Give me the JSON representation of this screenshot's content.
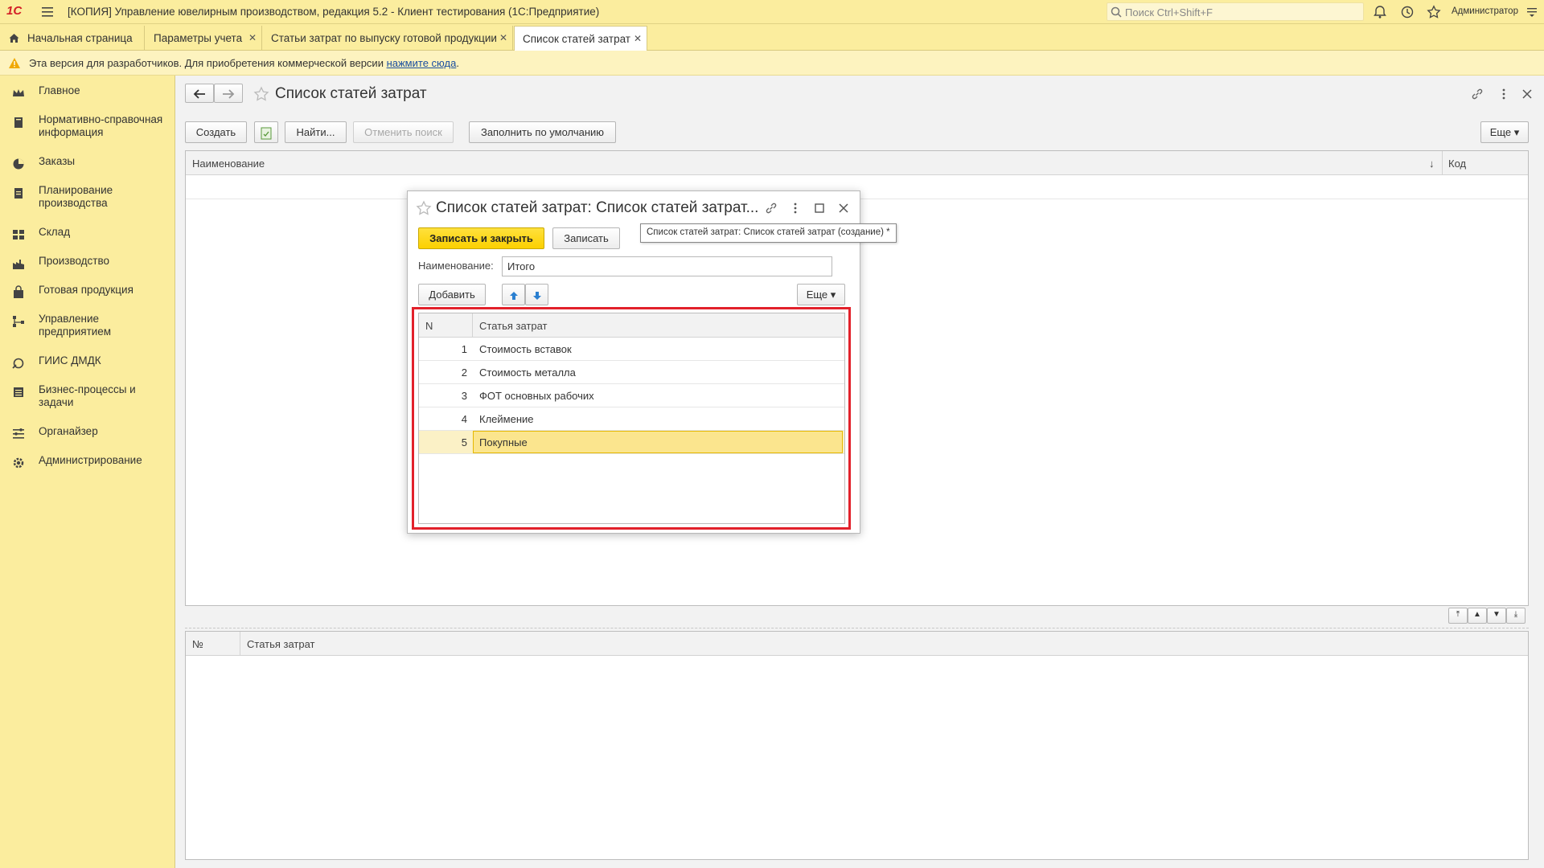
{
  "app": {
    "logo": "1С",
    "title": "[КОПИЯ] Управление ювелирным производством, редакция 5.2  - Клиент тестирования (1С:Предприятие)",
    "search_placeholder": "Поиск Ctrl+Shift+F",
    "user": "Администратор"
  },
  "tabs": [
    {
      "label": "Начальная страница",
      "closable": false
    },
    {
      "label": "Параметры учета",
      "closable": true
    },
    {
      "label": "Статьи затрат по выпуску готовой продукции",
      "closable": true
    },
    {
      "label": "Список статей затрат",
      "closable": true,
      "active": true
    }
  ],
  "warning": {
    "text": "Эта версия для разработчиков. Для приобретения коммерческой версии ",
    "link": "нажмите сюда",
    "tail": "."
  },
  "sidebar": {
    "items": [
      {
        "label": "Главное",
        "icon": "crown-icon"
      },
      {
        "label": "Нормативно-справочная информация",
        "icon": "book-icon"
      },
      {
        "label": "Заказы",
        "icon": "pie-icon"
      },
      {
        "label": "Планирование производства",
        "icon": "clipboard-icon"
      },
      {
        "label": "Склад",
        "icon": "warehouse-icon"
      },
      {
        "label": "Производство",
        "icon": "factory-icon"
      },
      {
        "label": "Готовая продукция",
        "icon": "bag-icon"
      },
      {
        "label": "Управление предприятием",
        "icon": "org-icon"
      },
      {
        "label": "ГИИС ДМДК",
        "icon": "sync-icon"
      },
      {
        "label": "Бизнес-процессы и задачи",
        "icon": "tasks-icon"
      },
      {
        "label": "Органайзер",
        "icon": "organizer-icon"
      },
      {
        "label": "Администрирование",
        "icon": "gear-icon"
      }
    ]
  },
  "page": {
    "title": "Список статей затрат",
    "toolbar": {
      "create": "Создать",
      "find": "Найти...",
      "cancel_search": "Отменить поиск",
      "fill_default": "Заполнить по умолчанию",
      "more": "Еще"
    },
    "main_grid": {
      "col_name": "Наименование",
      "col_code": "Код"
    },
    "bottom_grid": {
      "col_no": "№",
      "col_item": "Статья затрат"
    }
  },
  "modal": {
    "title": "Список статей затрат: Список статей затрат...",
    "save_close": "Записать и закрыть",
    "save": "Записать",
    "name_label": "Наименование:",
    "name_value": "Итого",
    "add": "Добавить",
    "more": "Еще",
    "table": {
      "col_n": "N",
      "col_item": "Статья затрат",
      "rows": [
        {
          "n": "1",
          "item": "Стоимость вставок"
        },
        {
          "n": "2",
          "item": "Стоимость металла"
        },
        {
          "n": "3",
          "item": "ФОТ основных рабочих"
        },
        {
          "n": "4",
          "item": "Клеймение"
        },
        {
          "n": "5",
          "item": "Покупные",
          "selected": true
        }
      ]
    }
  },
  "tooltip": "Список статей затрат: Список статей затрат (создание) *",
  "colors": {
    "accent": "#fbd000",
    "highlight": "#e2212b",
    "sidebar": "#fbed9e"
  }
}
